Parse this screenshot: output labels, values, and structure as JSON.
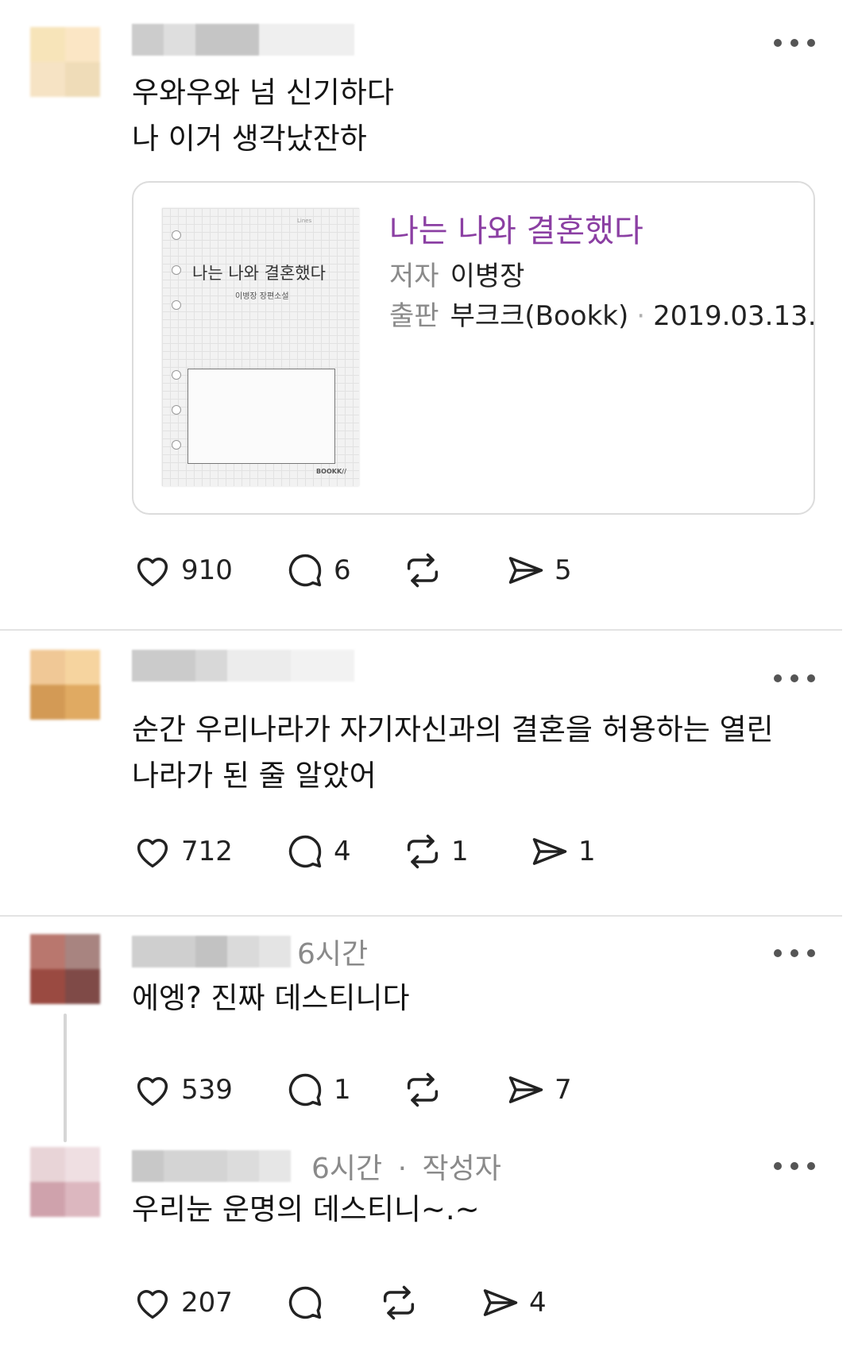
{
  "posts": [
    {
      "text": "우와우와 넘 신기하다\n나 이거 생각났잔하",
      "book": {
        "title": "나는 나와 결혼했다",
        "author_label": "저자",
        "author": "이병장",
        "publisher_label": "출판",
        "publisher": "부크크(Bookk)",
        "separator": "·",
        "date": "2019.03.13.",
        "cover_title": "나는 나와 결혼했다",
        "cover_subtitle": "이병장 장편소설",
        "cover_brand": "BOOKK//",
        "cover_top": "Lines"
      },
      "likes": "910",
      "comments": "6",
      "reposts": "",
      "shares": "5",
      "avatar_colors": [
        "#f7e4b9",
        "#fbe6c5",
        "#f6e3c4",
        "#efdcb8"
      ],
      "name_colors": [
        "#cccccc",
        "#dedede",
        "#c5c5c5",
        "#efefef"
      ]
    },
    {
      "text": "순간 우리나라가 자기자신과의 결혼을 허용하는 열린\n나라가 된 줄 알았어",
      "likes": "712",
      "comments": "4",
      "reposts": "1",
      "shares": "1",
      "avatar_colors": [
        "#f0c896",
        "#f6d49f",
        "#d39a55",
        "#e0aa62"
      ],
      "name_colors": [
        "#cbcbcb",
        "#d8d8d8",
        "#ececec",
        "#f2f2f2"
      ]
    },
    {
      "time": "6시간",
      "text": "에엥? 진짜 데스티니다",
      "likes": "539",
      "comments": "1",
      "reposts": "",
      "shares": "7",
      "avatar_colors": [
        "#b9776e",
        "#a88480",
        "#9a4a41",
        "#7f4a47"
      ],
      "name_colors": [
        "#cfcfcf",
        "#c2c2c2",
        "#dadada",
        "#e4e4e4"
      ]
    },
    {
      "time": "6시간",
      "separator": "·",
      "author_tag": "작성자",
      "text": "우리눈 운명의 데스티니~.~",
      "likes": "207",
      "comments": "",
      "reposts": "",
      "shares": "4",
      "avatar_colors": [
        "#e8d4d7",
        "#efdfe2",
        "#cfa2ac",
        "#dcb7bf"
      ],
      "name_colors": [
        "#c8c8c8",
        "#d4d4d4",
        "#dcdcdc",
        "#e6e6e6"
      ]
    }
  ],
  "colors": {
    "book_title": "#8b3fa3",
    "meta_gray": "#8a8a8a",
    "divider": "#e3e3e3"
  },
  "icons": [
    "heart-icon",
    "comment-icon",
    "repost-icon",
    "share-icon",
    "more-icon"
  ]
}
